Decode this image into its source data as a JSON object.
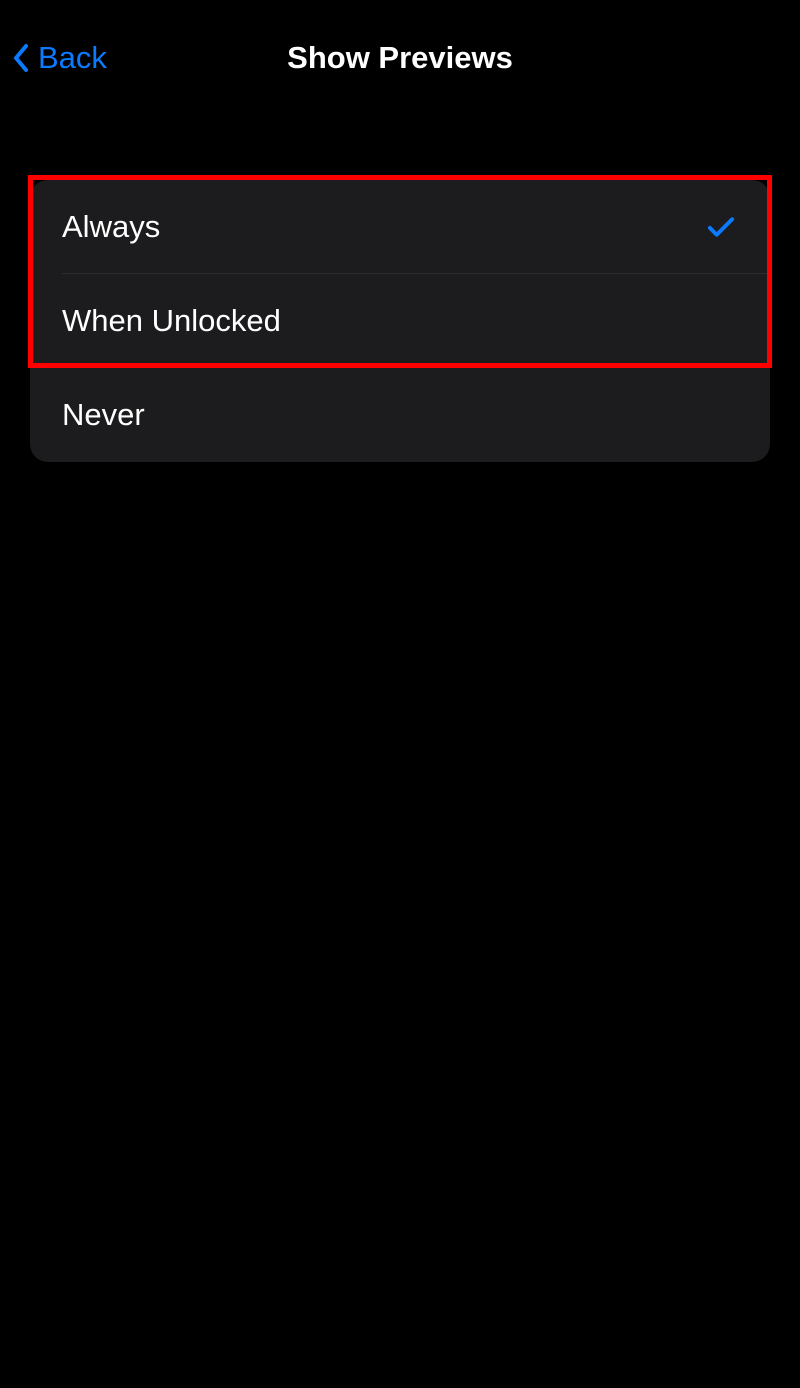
{
  "nav": {
    "back_label": "Back",
    "title": "Show Previews"
  },
  "options": [
    {
      "label": "Always",
      "selected": true
    },
    {
      "label": "When Unlocked",
      "selected": false
    },
    {
      "label": "Never",
      "selected": false
    }
  ],
  "colors": {
    "accent": "#0a7aff",
    "highlight": "#ff0000",
    "list_bg": "#1c1c1e"
  }
}
